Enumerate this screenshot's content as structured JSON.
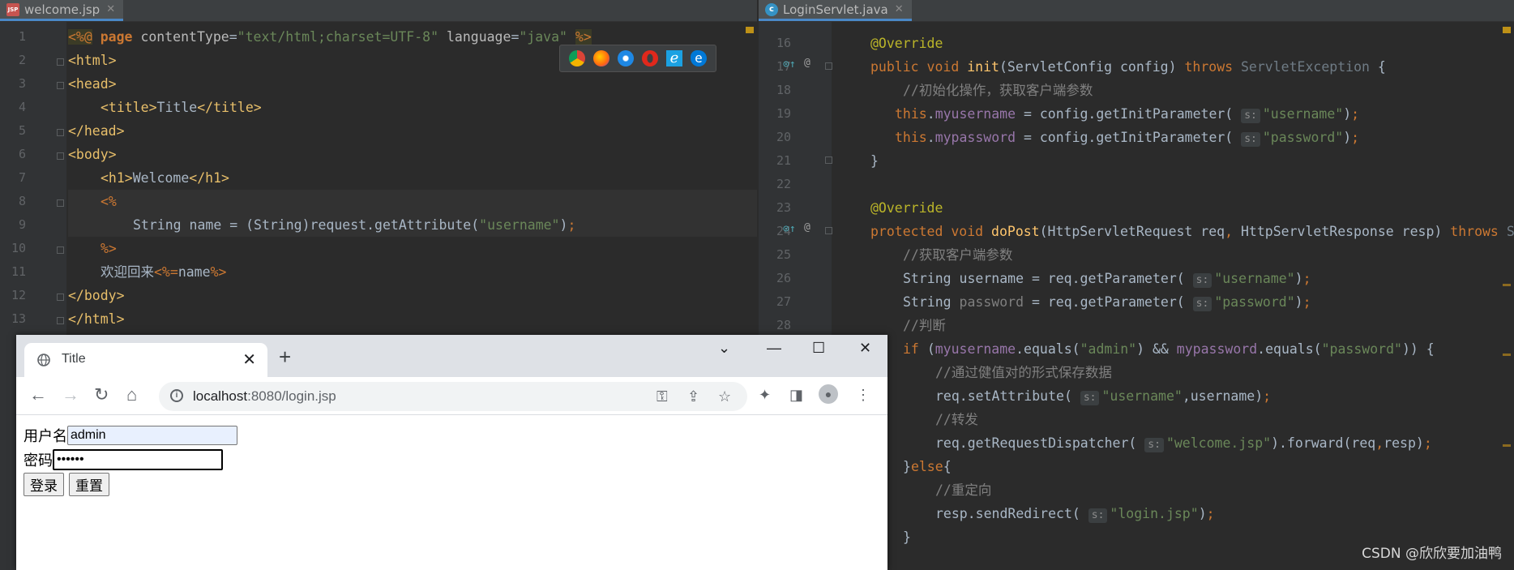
{
  "left_editor": {
    "tab": {
      "label": "welcome.jsp",
      "icon": "jsp-file-icon"
    },
    "line_numbers": [
      "1",
      "2",
      "3",
      "4",
      "5",
      "6",
      "7",
      "8",
      "9",
      "10",
      "11",
      "12",
      "13"
    ]
  },
  "right_editor": {
    "tab": {
      "label": "LoginServlet.java",
      "icon": "java-class-icon"
    },
    "line_numbers": [
      "16",
      "17",
      "18",
      "19",
      "20",
      "21",
      "22",
      "23",
      "24",
      "25",
      "26",
      "27",
      "28"
    ]
  },
  "browser_bar": [
    "chrome-icon",
    "firefox-icon",
    "safari-icon",
    "opera-icon",
    "ie-icon",
    "edge-icon"
  ],
  "browser": {
    "tab_title": "Title",
    "url_host": "localhost",
    "url_rest": ":8080/login.jsp",
    "form": {
      "username_label": "用户名",
      "username_value": "admin",
      "password_label": "密码",
      "password_value": "••••••",
      "login_button": "登录",
      "reset_button": "重置"
    }
  },
  "watermark": "CSDN @欣欣要加油鸭",
  "colors": {
    "keyword": "#cc7832",
    "string": "#6a8759",
    "comment": "#808080",
    "annotation": "#bbb529",
    "field": "#9876aa",
    "method": "#ffc66d",
    "background": "#2b2b2b"
  }
}
